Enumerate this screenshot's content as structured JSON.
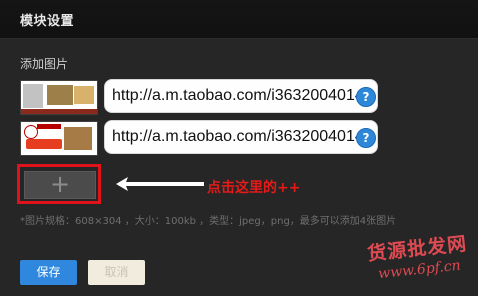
{
  "header": {
    "title": "模块设置"
  },
  "section": {
    "label": "添加图片"
  },
  "rows": [
    {
      "url": "http://a.m.taobao.com/i3632004014"
    },
    {
      "url": "http://a.m.taobao.com/i3632004014"
    }
  ],
  "help": {
    "symbol": "?"
  },
  "add_button": {
    "symbol": "+"
  },
  "annotation": {
    "text": "点击这里的++"
  },
  "hint": {
    "text": "*图片规格：608×304 ，大小：100kb ，类型：jpeg，png，最多可以添加4张图片"
  },
  "actions": {
    "save_label": "保存",
    "cancel_label": "取消"
  },
  "watermark": {
    "line1": "货源批发网",
    "line2": "www.6pf.cn"
  },
  "colors": {
    "accent": "#2f88de",
    "highlight": "#e0131b",
    "background": "#262626",
    "header": "#141414"
  },
  "icons": {
    "help": "question-circle-icon",
    "add": "plus-icon",
    "arrow": "arrow-left-icon"
  }
}
